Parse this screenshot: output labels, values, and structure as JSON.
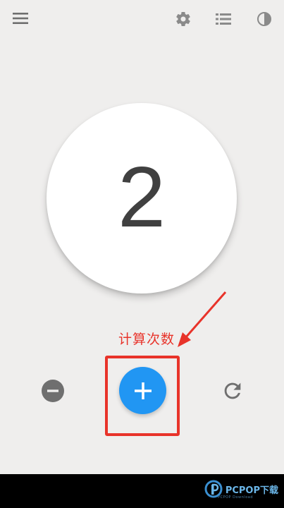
{
  "toolbar": {
    "menu_icon": "hamburger-menu-icon",
    "settings_icon": "gear-icon",
    "history_icon": "list-icon",
    "theme_icon": "contrast-icon"
  },
  "counter": {
    "value": "2"
  },
  "annotation": {
    "label": "计算次数",
    "color": "#e8332a"
  },
  "controls": {
    "decrement_icon": "minus-circle-icon",
    "increment_icon": "plus-icon",
    "reset_icon": "refresh-icon",
    "accent_color": "#2196f3"
  },
  "watermark": {
    "text": "PCPOP下载",
    "subtext": "PCPOP Download"
  }
}
